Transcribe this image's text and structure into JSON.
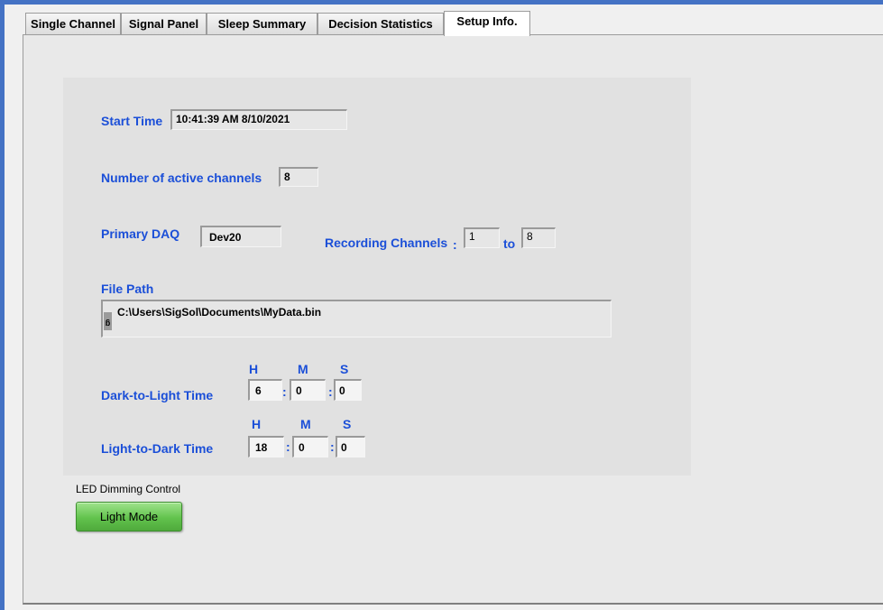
{
  "tabs": [
    {
      "label": "Single Channel"
    },
    {
      "label": "Signal Panel"
    },
    {
      "label": "Sleep Summary"
    },
    {
      "label": "Decision Statistics"
    },
    {
      "label": "Setup Info."
    }
  ],
  "active_tab": "Setup Info.",
  "setup": {
    "start_time_label": "Start Time",
    "start_time_value": "10:41:39 AM 8/10/2021",
    "channels_label": "Number of active channels",
    "channels_value": "8",
    "daq_label": "Primary DAQ",
    "daq_value": "Dev20",
    "recording_label": "Recording Channels",
    "recording_colon": ":",
    "recording_from": "1",
    "recording_to_label": "to",
    "recording_to": "8",
    "file_path_label": "File Path",
    "file_path_value": "C:\\Users\\SigSol\\Documents\\MyData.bin",
    "path_icon_glyph": "ᵷ",
    "time_headers": {
      "h": "H",
      "m": "M",
      "s": "S"
    },
    "time_colon": ":",
    "dark_to_light": {
      "label": "Dark-to-Light Time",
      "h": "6",
      "m": "0",
      "s": "0"
    },
    "light_to_dark": {
      "label": "Light-to-Dark Time",
      "h": "18",
      "m": "0",
      "s": "0"
    }
  },
  "led": {
    "label": "LED Dimming Control",
    "button": "Light Mode"
  },
  "colors": {
    "accent": "#4472c4",
    "label_blue": "#1b4fd8",
    "button_green": "#62c34d"
  }
}
